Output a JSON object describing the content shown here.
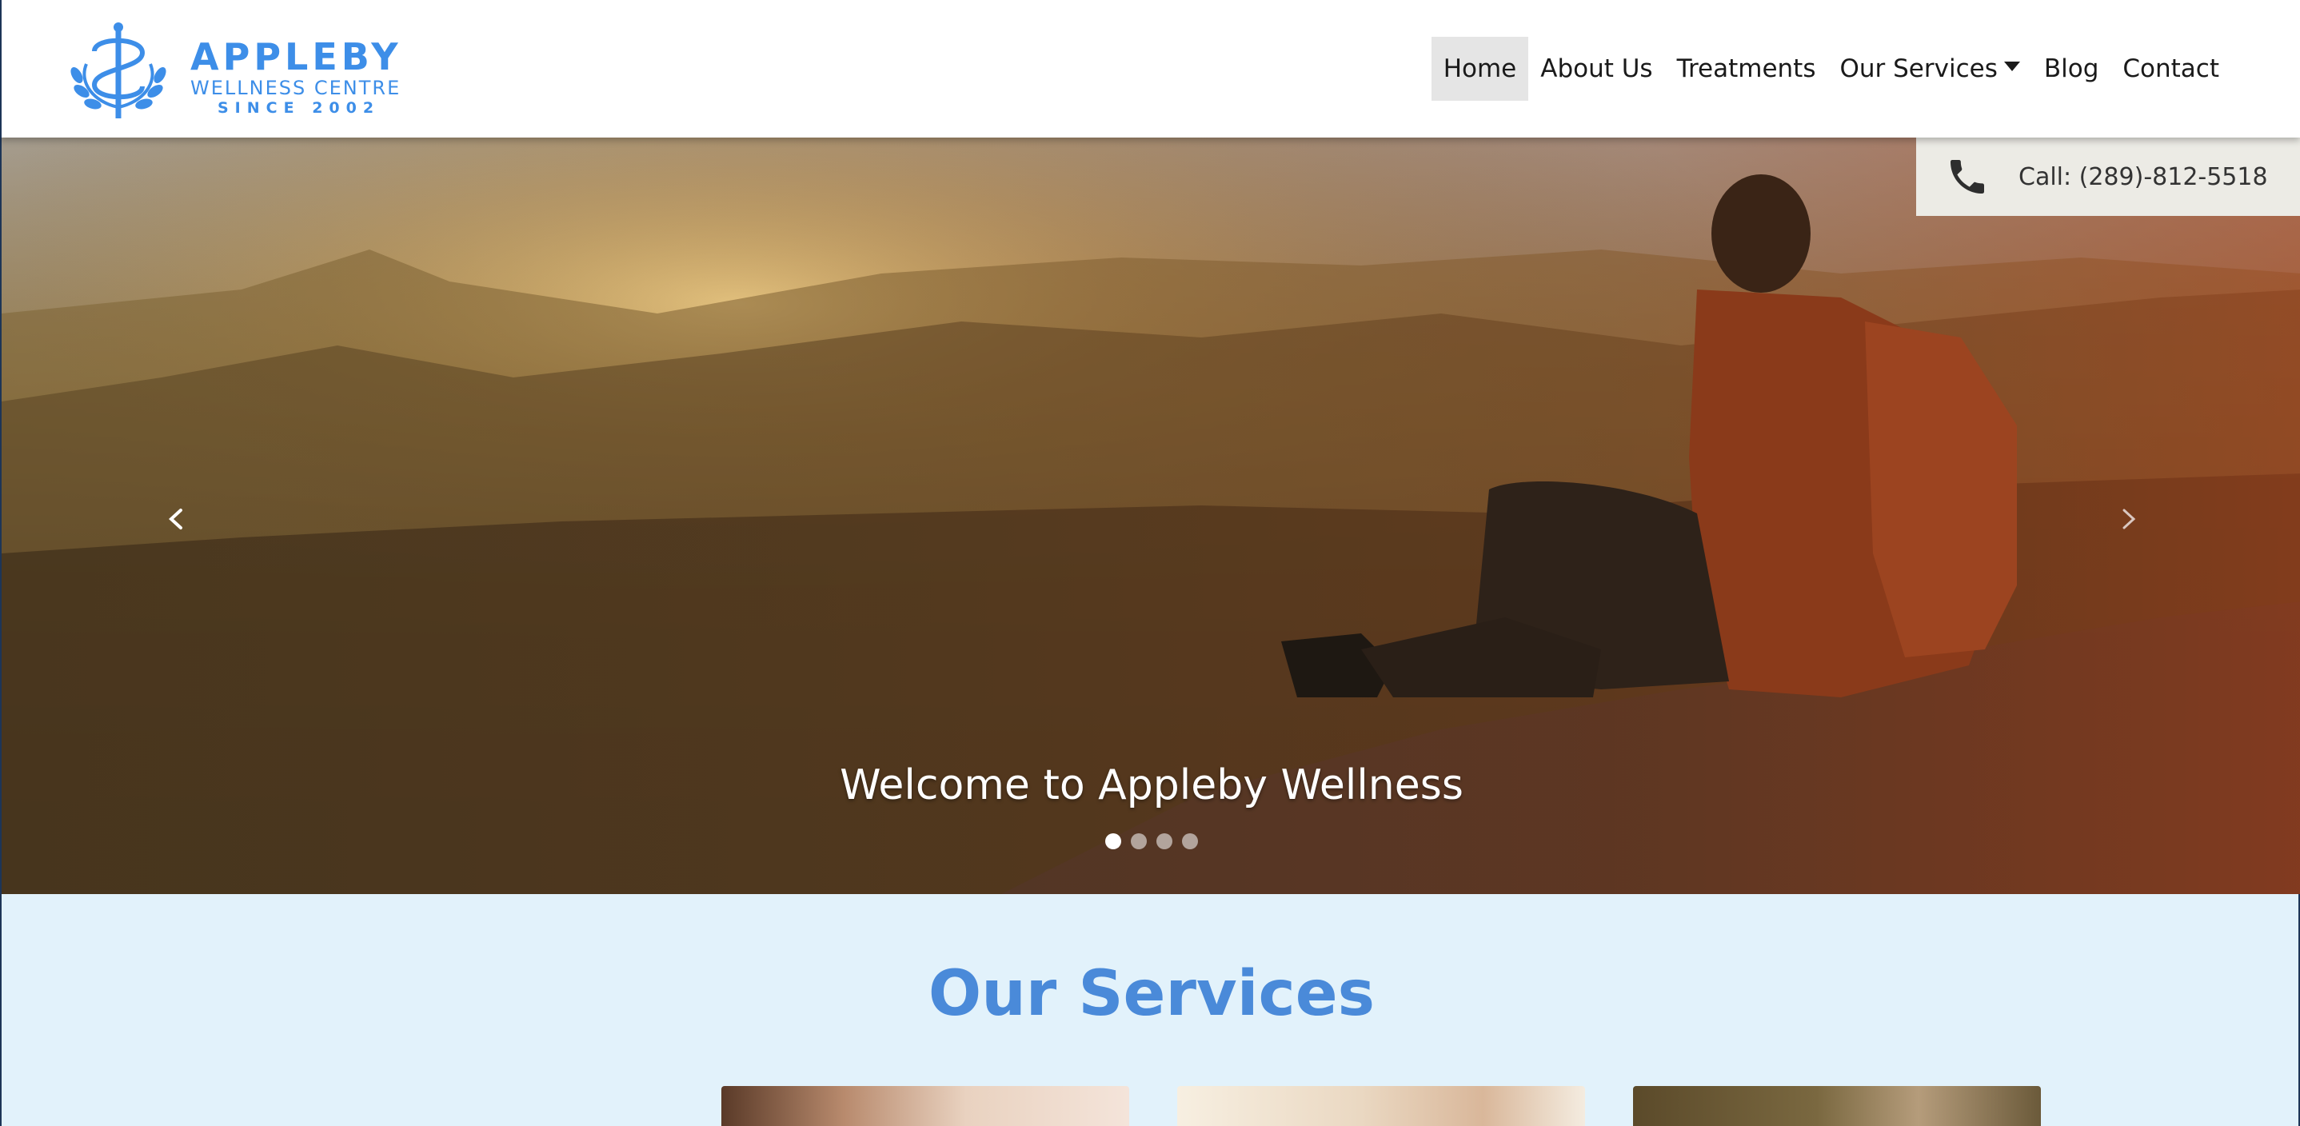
{
  "brand": {
    "name": "APPLEBY",
    "subtitle": "WELLNESS CENTRE",
    "since": "SINCE 2002",
    "color": "#3d8ee8"
  },
  "nav": {
    "items": [
      {
        "label": "Home",
        "active": true
      },
      {
        "label": "About Us"
      },
      {
        "label": "Treatments"
      },
      {
        "label": "Our Services",
        "dropdown": true
      },
      {
        "label": "Blog"
      },
      {
        "label": "Contact"
      }
    ]
  },
  "hero": {
    "call_label": "Call: (289)-812-5518",
    "phone_icon": "phone-icon",
    "caption": "Welcome to Appleby Wellness",
    "slide_count": 4,
    "active_slide": 0,
    "prev_icon": "chevron-left-icon",
    "next_icon": "chevron-right-icon"
  },
  "services": {
    "title": "Our Services",
    "title_color": "#4a8ad9",
    "background": "#e2f2fb"
  }
}
